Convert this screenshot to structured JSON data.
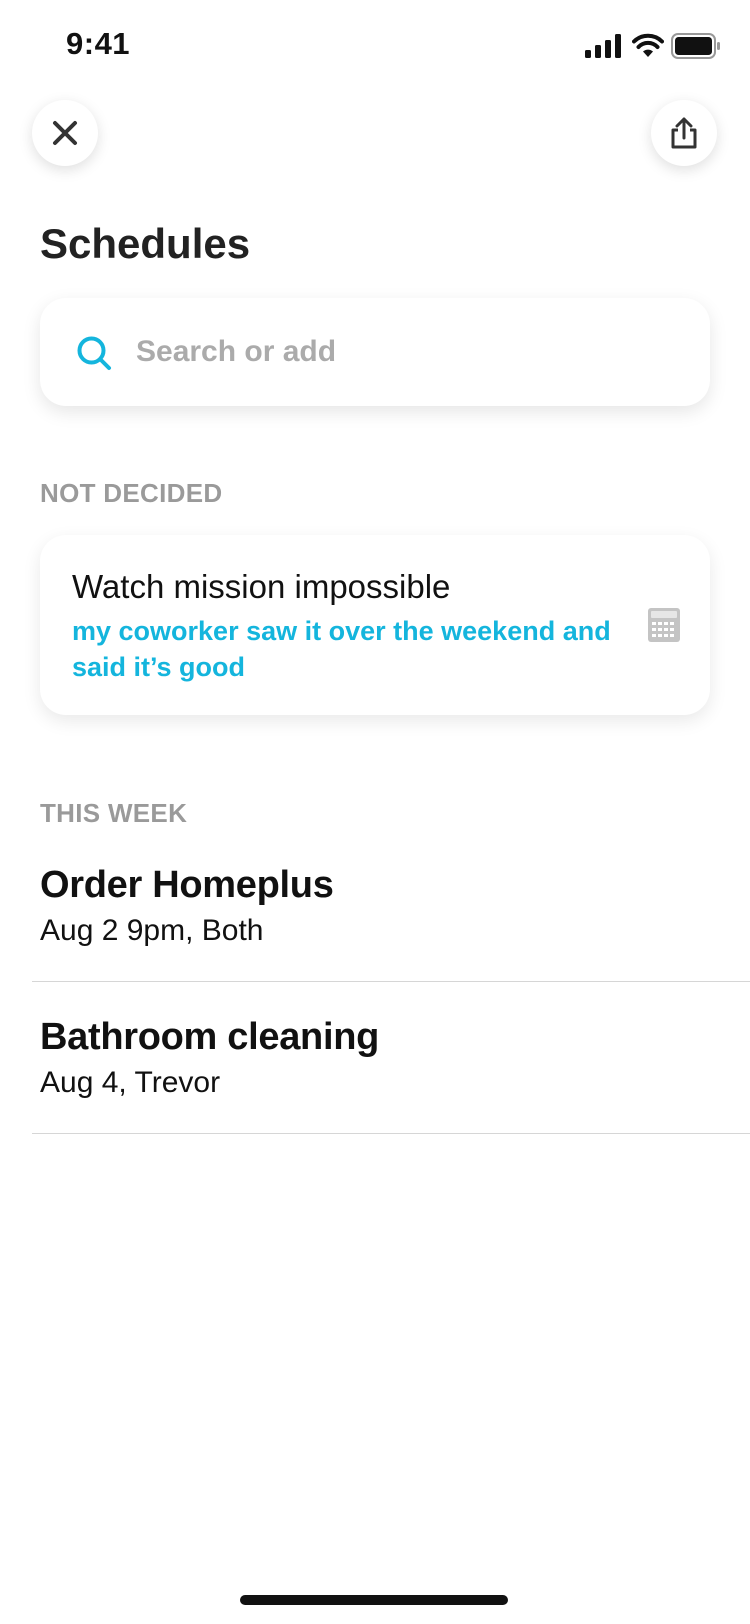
{
  "status_bar": {
    "time": "9:41"
  },
  "header": {
    "close_icon": "close-icon",
    "share_icon": "share-icon",
    "title": "Schedules"
  },
  "search": {
    "placeholder": "Search or add",
    "value": "",
    "icon": "search-icon"
  },
  "sections": {
    "not_decided": {
      "label": "NOT DECIDED",
      "card": {
        "title": "Watch mission impossible",
        "note": "my coworker saw it over the weekend and said it’s good",
        "icon": "calendar-icon"
      }
    },
    "this_week": {
      "label": "THIS WEEK",
      "items": [
        {
          "title": "Order Homeplus",
          "subtitle": "Aug 2 9pm, Both"
        },
        {
          "title": "Bathroom cleaning",
          "subtitle": "Aug 4, Trevor"
        }
      ]
    }
  },
  "colors": {
    "accent": "#14b5dd",
    "section_label": "#9a9a9a",
    "placeholder": "#ababab"
  }
}
